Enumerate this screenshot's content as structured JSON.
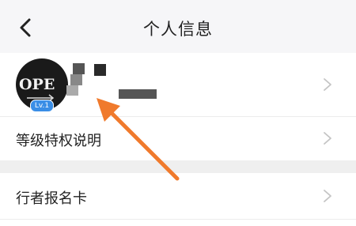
{
  "header": {
    "title": "个人信息",
    "back_icon": "chevron-left-icon"
  },
  "profile": {
    "avatar_text": "OPE",
    "level_badge": "Lv.1",
    "chevron_icon": "chevron-right-icon"
  },
  "menu": {
    "privilege_label": "等级特权说明",
    "card_label": "行者报名卡"
  },
  "colors": {
    "header_bg": "#f6f6f8",
    "badge_blue": "#3a8ee6",
    "annotation_orange": "#f07a2c",
    "chevron_gray": "#c4c4c4"
  }
}
